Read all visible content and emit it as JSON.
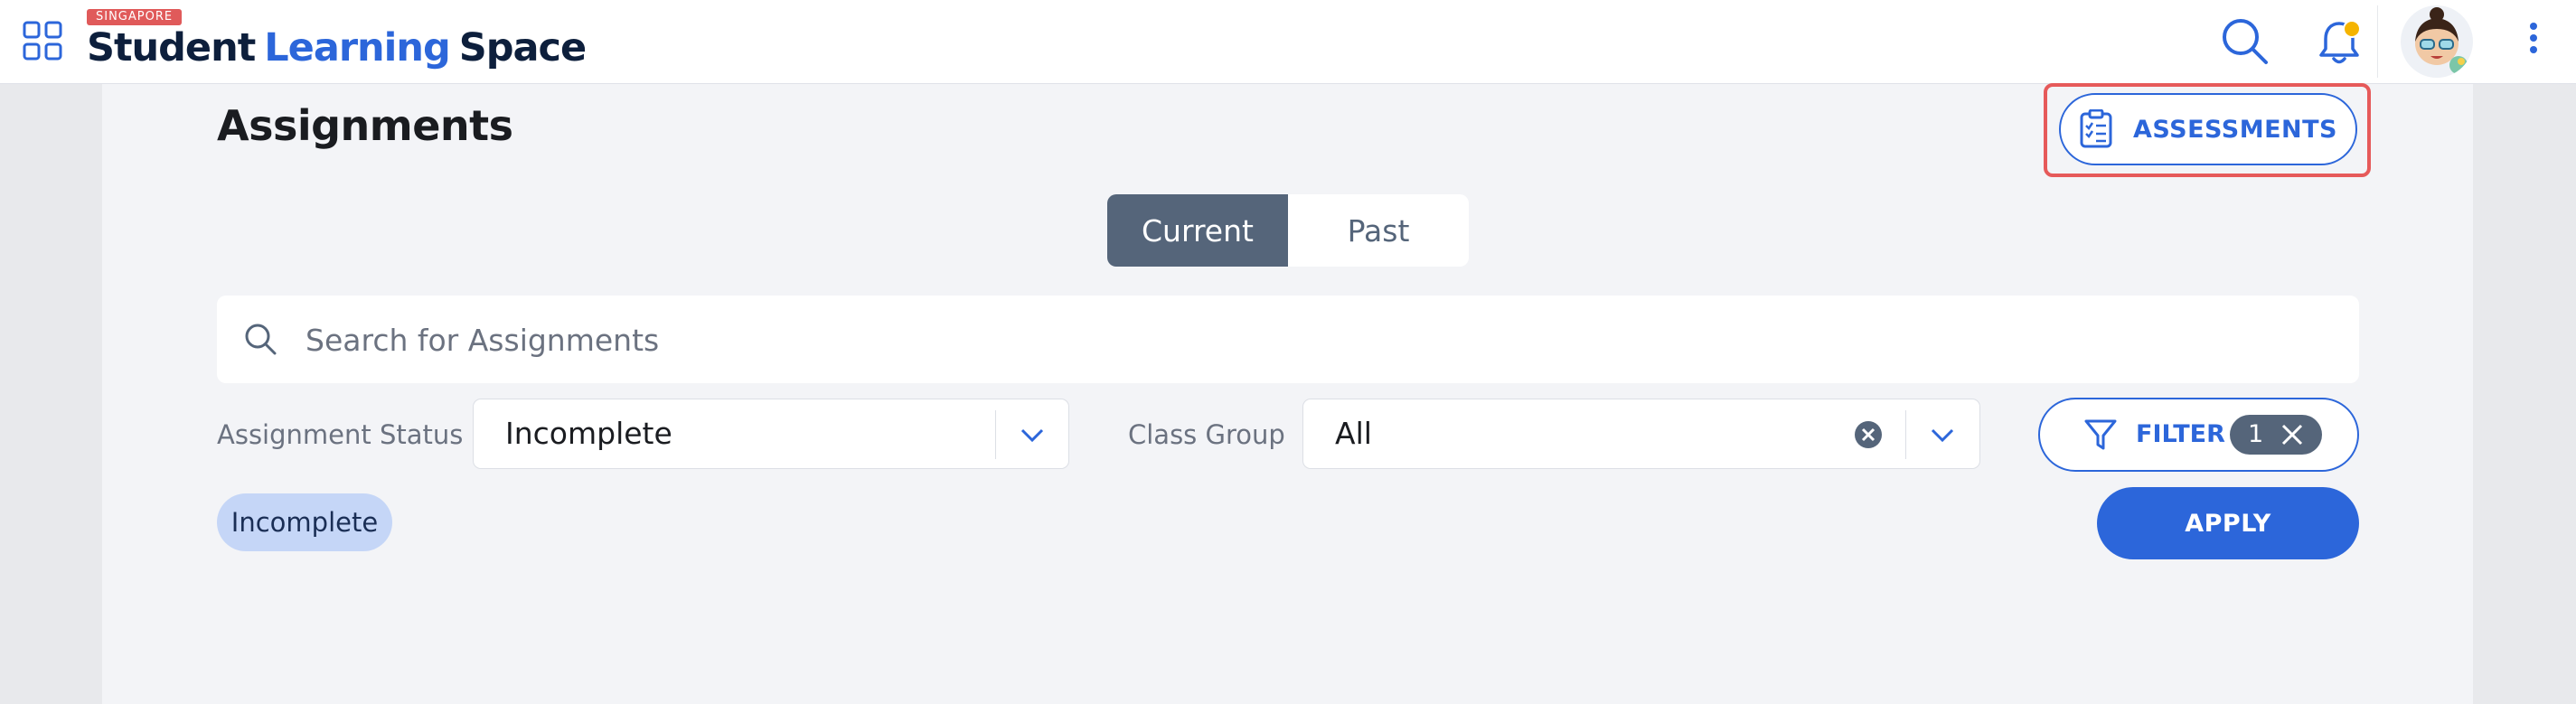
{
  "header": {
    "logo_badge": "SINGAPORE",
    "logo_word1": "Student",
    "logo_word2": "Learning",
    "logo_word3": "Space",
    "icons": [
      "apps-grid-icon",
      "search-icon",
      "bell-icon",
      "avatar",
      "more-vertical-icon"
    ],
    "notification_dot_color": "#f5b400"
  },
  "page": {
    "title": "Assignments",
    "assessments_button": "ASSESSMENTS",
    "assessments_icon": "clipboard-checklist-icon",
    "highlight_color": "#e65a5a"
  },
  "tabs": [
    {
      "label": "Current",
      "active": true
    },
    {
      "label": "Past",
      "active": false
    }
  ],
  "search": {
    "placeholder": "Search for Assignments"
  },
  "filters": {
    "status_label": "Assignment Status",
    "status_value": "Incomplete",
    "class_group_label": "Class Group",
    "class_group_value": "All",
    "filter_button": "FILTER",
    "filter_count": "1",
    "active_chip": "Incomplete",
    "apply_button": "APPLY"
  },
  "colors": {
    "accent": "#2c66da",
    "tab_active_bg": "#55657a",
    "chip_bg": "#c5d6f7"
  }
}
